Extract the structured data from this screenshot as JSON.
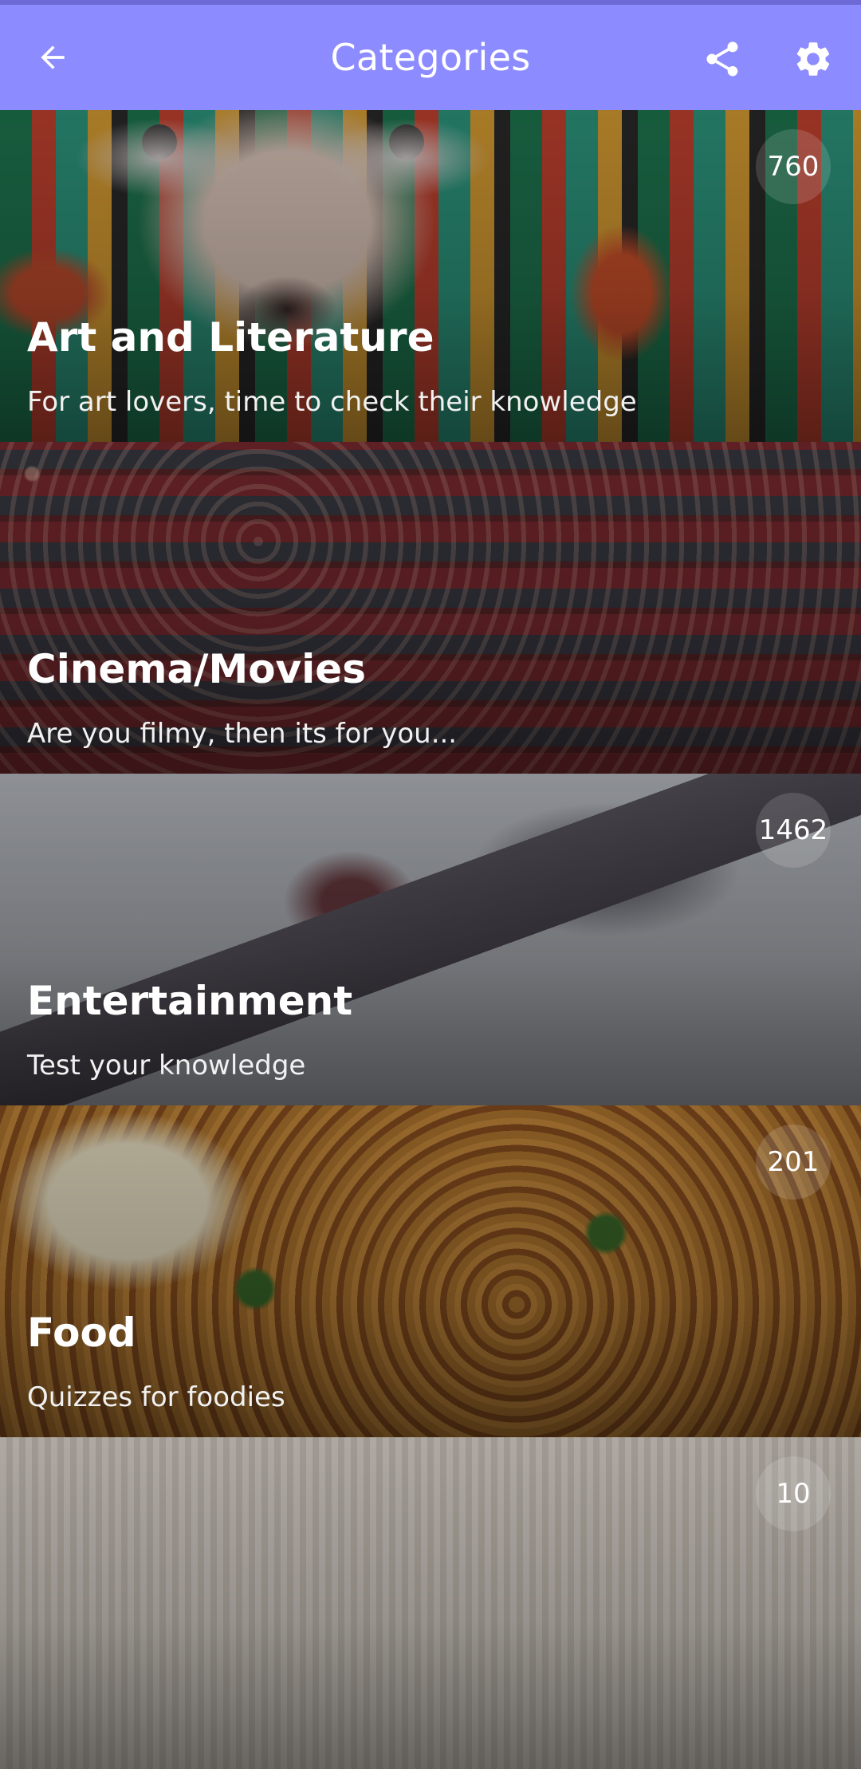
{
  "app_bar": {
    "title": "Categories",
    "back_icon": "arrow-left-icon",
    "share_icon": "share-icon",
    "settings_icon": "gear-icon",
    "background_color": "#8c8bff"
  },
  "categories": [
    {
      "name": "Art and Literature",
      "description": "For art lovers, time to check their knowledge",
      "count": "760"
    },
    {
      "name": "Cinema/Movies",
      "description": "Are you filmy, then its for you...",
      "count": ""
    },
    {
      "name": "Entertainment",
      "description": "Test your knowledge",
      "count": "1462"
    },
    {
      "name": "Food",
      "description": "Quizzes for foodies",
      "count": "201"
    },
    {
      "name": "",
      "description": "",
      "count": "10"
    }
  ]
}
